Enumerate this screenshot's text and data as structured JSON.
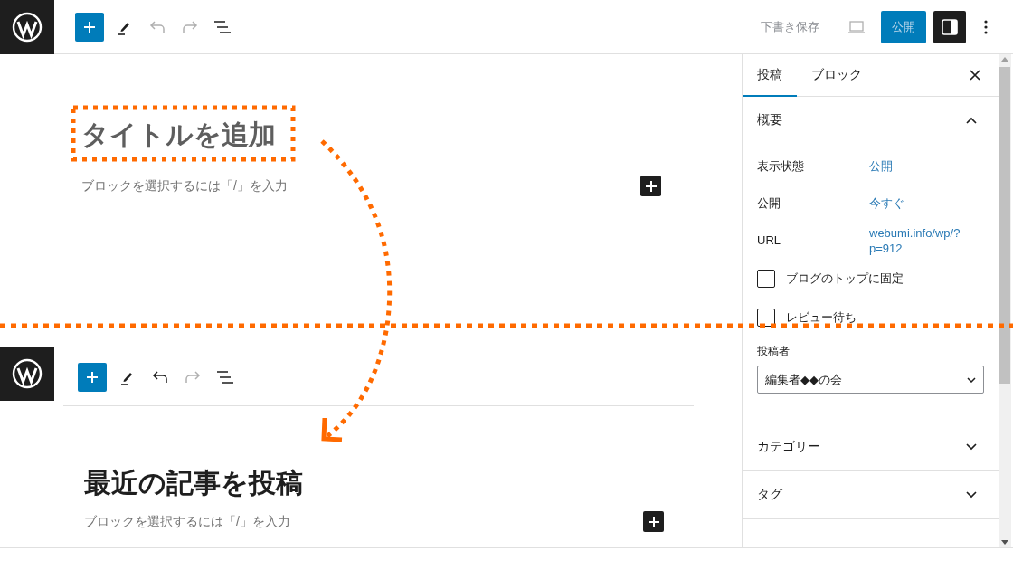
{
  "top_bar": {
    "tools": [
      {
        "kind": "inserter",
        "disabled": false
      },
      {
        "kind": "edit",
        "disabled": false
      },
      {
        "kind": "undo",
        "disabled": true
      },
      {
        "kind": "redo",
        "disabled": true
      },
      {
        "kind": "list_view",
        "disabled": false
      }
    ],
    "save_draft": "下書き保存",
    "publish": "公開",
    "settings_open": true
  },
  "editor": {
    "title_placeholder": "タイトルを追加",
    "block_placeholder": "ブロックを選択するには「/」を入力"
  },
  "sidebar": {
    "tabs": [
      {
        "label": "投稿",
        "selected": true
      },
      {
        "label": "ブロック",
        "selected": false
      }
    ],
    "summary": {
      "title": "概要",
      "expanded": true,
      "rows": [
        {
          "label": "表示状態",
          "value": "公開"
        },
        {
          "label": "公開",
          "value": "今すぐ"
        },
        {
          "label": "URL",
          "value": "webumi.info/wp/?p=912"
        }
      ],
      "checkboxes": [
        {
          "label": "ブログのトップに固定",
          "checked": false
        },
        {
          "label": "レビュー待ち",
          "checked": false
        }
      ],
      "author": {
        "label": "投稿者",
        "value": "編集者◆◆の会"
      }
    },
    "panels": [
      {
        "title": "カテゴリー",
        "expanded": false
      },
      {
        "title": "タグ",
        "expanded": false
      }
    ]
  },
  "inset": {
    "tools": [
      {
        "kind": "inserter",
        "disabled": false
      },
      {
        "kind": "edit",
        "disabled": false
      },
      {
        "kind": "undo",
        "disabled": false
      },
      {
        "kind": "redo",
        "disabled": true
      },
      {
        "kind": "list_view",
        "disabled": false
      }
    ],
    "title": "最近の記事を投稿",
    "block_placeholder": "ブロックを選択するには「/」を入力"
  }
}
